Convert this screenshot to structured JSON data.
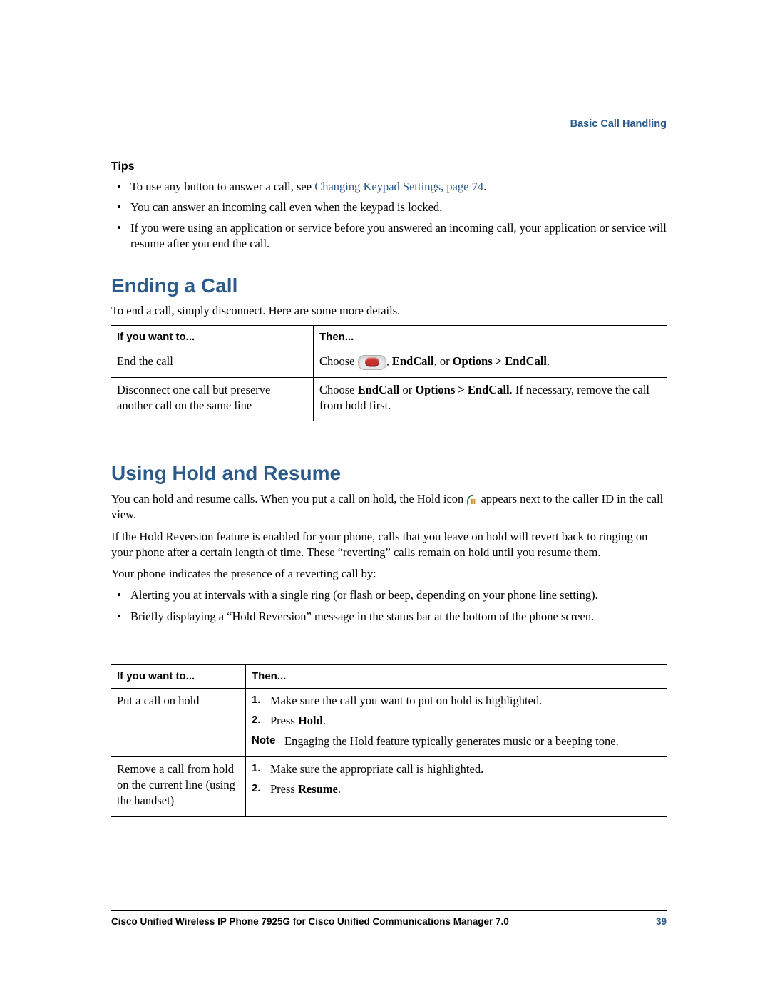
{
  "header": {
    "section": "Basic Call Handling"
  },
  "tips": {
    "heading": "Tips",
    "items": {
      "a_pre": "To use any button to answer a call, see ",
      "a_link": "Changing Keypad Settings, page 74",
      "a_post": ".",
      "b": "You can answer an incoming call even when the keypad is locked.",
      "c": "If you were using an application or service before you answered an incoming call, your application or service will resume after you end the call."
    }
  },
  "ending": {
    "heading": "Ending a Call",
    "intro": "To end a call, simply disconnect. Here are some more details.",
    "th1": "If you want to...",
    "th2": "Then...",
    "r1c1": "End the call",
    "r1c2_pre": "Choose ",
    "r1c2_mid1": ", ",
    "r1c2_b1": "EndCall",
    "r1c2_mid2": ", or ",
    "r1c2_b2": "Options > EndCall",
    "r1c2_post": ".",
    "r2c1": "Disconnect one call but preserve another call on the same line",
    "r2c2_pre": "Choose ",
    "r2c2_b1": "EndCall",
    "r2c2_mid": " or ",
    "r2c2_b2": "Options > EndCall",
    "r2c2_post": ". If necessary, remove the call from hold first."
  },
  "hold": {
    "heading": "Using Hold and Resume",
    "p1_pre": "You can hold and resume calls. When you put a call on hold, the Hold icon ",
    "p1_post": " appears next to the caller ID in the call view.",
    "p2": "If the Hold Reversion feature is enabled for your phone, calls that you leave on hold will revert back to ringing on your phone after a certain length of time. These “reverting” calls remain on hold until you resume them.",
    "p3": "Your phone indicates the presence of a reverting call by:",
    "blist": {
      "a": "Alerting you at intervals with a single ring (or flash or beep, depending on your phone line setting).",
      "b": "Briefly displaying a “Hold Reversion” message in the status bar at the bottom of the phone screen."
    },
    "th1": "If you want to...",
    "th2": "Then...",
    "rows": {
      "r1c1": "Put a call on hold",
      "r1_s1": "Make sure the call you want to put on hold is highlighted.",
      "r1_s2_pre": "Press ",
      "r1_s2_b": "Hold",
      "r1_s2_post": ".",
      "r1_note_label": "Note",
      "r1_note_body": "Engaging the Hold feature typically generates music or a beeping tone.",
      "r2c1": "Remove a call from hold on the current line (using the handset)",
      "r2_s1": "Make sure the appropriate call is highlighted.",
      "r2_s2_pre": "Press ",
      "r2_s2_b": "Resume",
      "r2_s2_post": "."
    }
  },
  "footer": {
    "title": "Cisco Unified Wireless IP Phone 7925G for Cisco Unified Communications Manager 7.0",
    "page": "39"
  },
  "nums": {
    "one": "1.",
    "two": "2."
  }
}
